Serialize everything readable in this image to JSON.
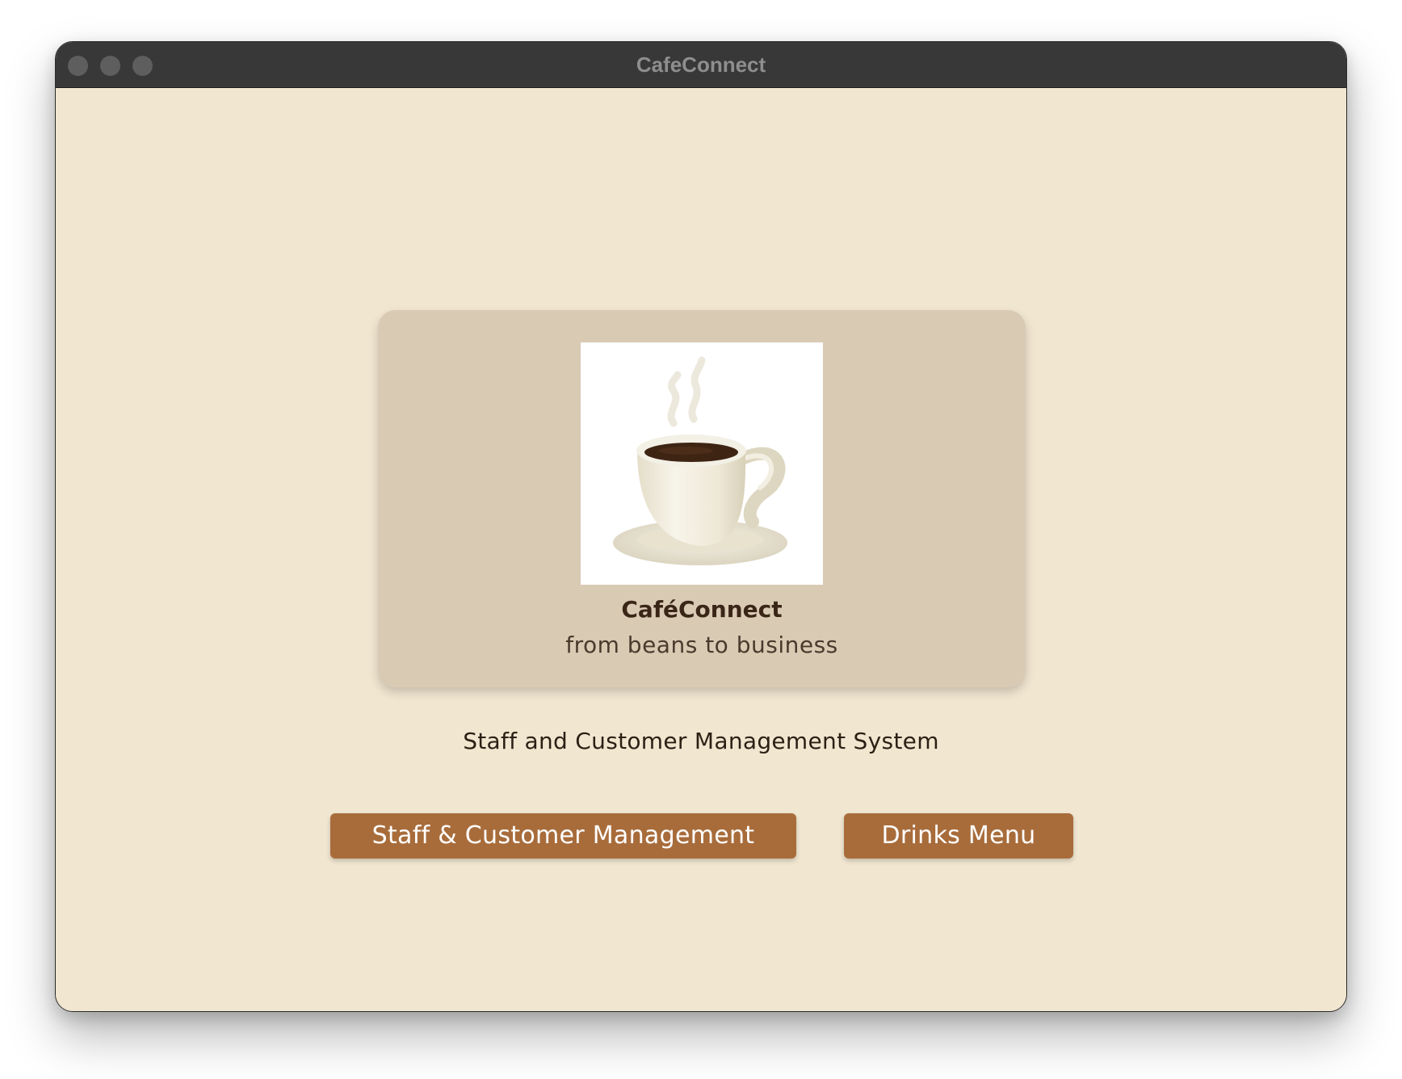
{
  "window": {
    "title": "CafeConnect"
  },
  "hero": {
    "app_name": "CaféConnect",
    "tagline": "from beans to business",
    "logo_icon": "coffee-cup-icon"
  },
  "subtitle": "Staff and Customer Management System",
  "buttons": {
    "management_label": "Staff & Customer Management",
    "menu_label": "Drinks Menu"
  },
  "colors": {
    "background": "#f1e6d0",
    "card": "#d9cab4",
    "button": "#a86c3b",
    "titlebar": "#383838"
  }
}
